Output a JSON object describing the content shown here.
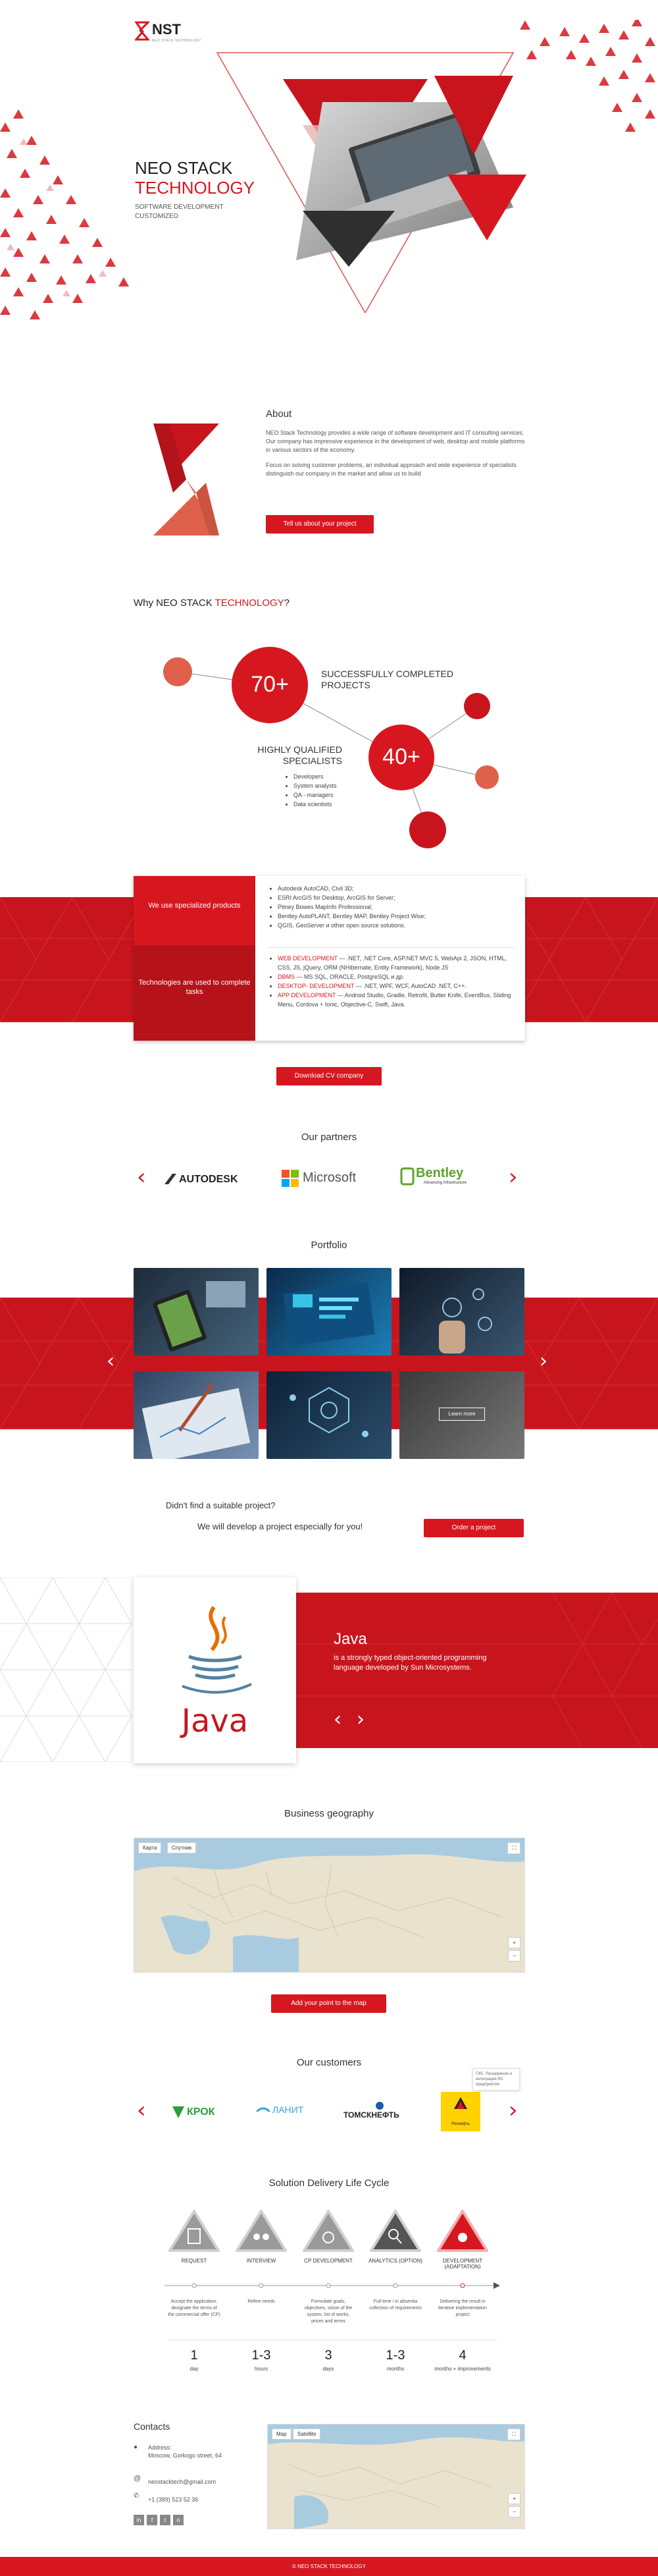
{
  "header": {
    "logo_text": "NST",
    "logo_sub": "NEO STACK TECHNOLOGY"
  },
  "hero": {
    "title_line1": "NEO STACK",
    "title_line2": "TECHNOLOGY",
    "subtitle_line1": "SOFTWARE DEVELOPMENT",
    "subtitle_line2": "CUSTOMIZED"
  },
  "about": {
    "heading": "About",
    "para1": "NEO Stack Technology provides a wide range of software development and IT consulting services. Our company has impressive experience in the development of web, desktop and mobile platforms in various sectors of the economy.",
    "para2": "Focus on solving customer problems, an individual approach and wide experience of specialists distinguish our company in the market and allow us to build",
    "button": "Tell us about your project"
  },
  "why": {
    "heading_pre": "Why NEO STACK ",
    "heading_accent": "TECHNOLOGY",
    "heading_post": "?",
    "stat1_value": "70+",
    "stat1_label_line1": "SUCCESSFULLY COMPLETED",
    "stat1_label_line2": "PROJECTS",
    "stat2_value": "40+",
    "stat2_label_line1": "HIGHLY QUALIFIED",
    "stat2_label_line2": "SPECIALISTS",
    "specialists": [
      "Developers",
      "System analysts",
      "QA - managers",
      "Data scientists"
    ]
  },
  "software": {
    "tab1": "We use specialized products",
    "tab2": "Technologies are used to complete tasks",
    "products": [
      "Autodesk AutoCAD, Civil 3D;",
      "ESRI ArcGIS for Desktop, ArcGIS for Server;",
      "Pitney Bowes MapInfo Professional;",
      "Bentley AutoPLANT, Bentley MAP, Bentley Project Wise;",
      "QGIS, GeoServer и other open source solutions."
    ],
    "tech": [
      {
        "key": "WEB DEVELOPMENT",
        "value": " — .NET, .NET Core, ASP.NET MVC 5, WebApi 2, JSON, HTML, CSS, JS, jQuery, ORM (NHibernate, Entity Framework), Node JS"
      },
      {
        "key": "DBMS",
        "value": " — MS SQL, ORACLE, PostgreSQL и др."
      },
      {
        "key": "DESKTOP- DEVELOPMENT",
        "value": " — .NET, WPF, WCF, AutoCAD .NET, C++."
      },
      {
        "key": "APP DEVELOPMENT",
        "value": " — Android Studio, Gradle, Retrofit, Butter Knife, EventBus, Sliding Menu, Cordova + Ionic, Objective-C, Swift, Java."
      }
    ],
    "button": "Download CV company"
  },
  "partners": {
    "heading": "Our partners",
    "logos": [
      "AUTODESK",
      "Microsoft",
      "Bentley"
    ],
    "bentley_sub": "Advancing Infrastructure"
  },
  "portfolio": {
    "heading": "Portfolio",
    "learn_more": "Learn more"
  },
  "cta": {
    "line1": "Didn't find a suitable project?",
    "line2": "We will develop a project especially for you!",
    "button": "Order a project"
  },
  "java": {
    "logo_text": "Java",
    "title": "Java",
    "desc": "is a strongly typed object-oriented programming language developed by Sun Microsystems."
  },
  "geo": {
    "heading": "Business geography",
    "tab_map": "Карта",
    "tab_sat": "Спутник",
    "button": "Add your point to the map"
  },
  "customers": {
    "heading": "Our customers",
    "logos": [
      "КРОК",
      "ЛАНИТ",
      "ТОМСКНЕФТЬ",
      "Роснефть"
    ],
    "tooltip": "ГИС. Расширение и интеграция ИС предприятия"
  },
  "cycle": {
    "heading": "Solution Delivery Life Cycle",
    "steps": [
      {
        "label": "REQUEST",
        "desc": "Accept the application, designate the terms of the commercial offer (CP)",
        "num": "1",
        "unit": "day"
      },
      {
        "label": "INTERVIEW",
        "desc": "Refine needs",
        "num": "1-3",
        "unit": "hours"
      },
      {
        "label": "CP DEVELOPMENT",
        "desc": "Formulate goals, objectives, vision of the system, list of works, prices and terms",
        "num": "3",
        "unit": "days"
      },
      {
        "label": "ANALYTICS (OPTION)",
        "desc": "Full-time / in absentia collection of requirements",
        "num": "1-3",
        "unit": "months"
      },
      {
        "label": "DEVELOPMENT (ADAPTATION)",
        "desc": "Delivering the result in iterative implementation project",
        "num": "4",
        "unit": "months + improvements"
      }
    ]
  },
  "contacts": {
    "heading": "Contacts",
    "address_label": "Address:",
    "address": "Moscow, Gorkogo street, 64",
    "email": "neostacktech@gmail.com",
    "phone": "+1 (389) 523 52 36",
    "tab_map": "Map",
    "tab_sat": "Satellite",
    "socials": [
      "in",
      "f",
      "t",
      "o"
    ]
  },
  "footer": {
    "text": "© NEO STACK TECHNOLOGY"
  },
  "colors": {
    "accent": "#d7171f",
    "dark_red": "#b5121a",
    "salmon": "#e0614b",
    "text": "#333333"
  }
}
